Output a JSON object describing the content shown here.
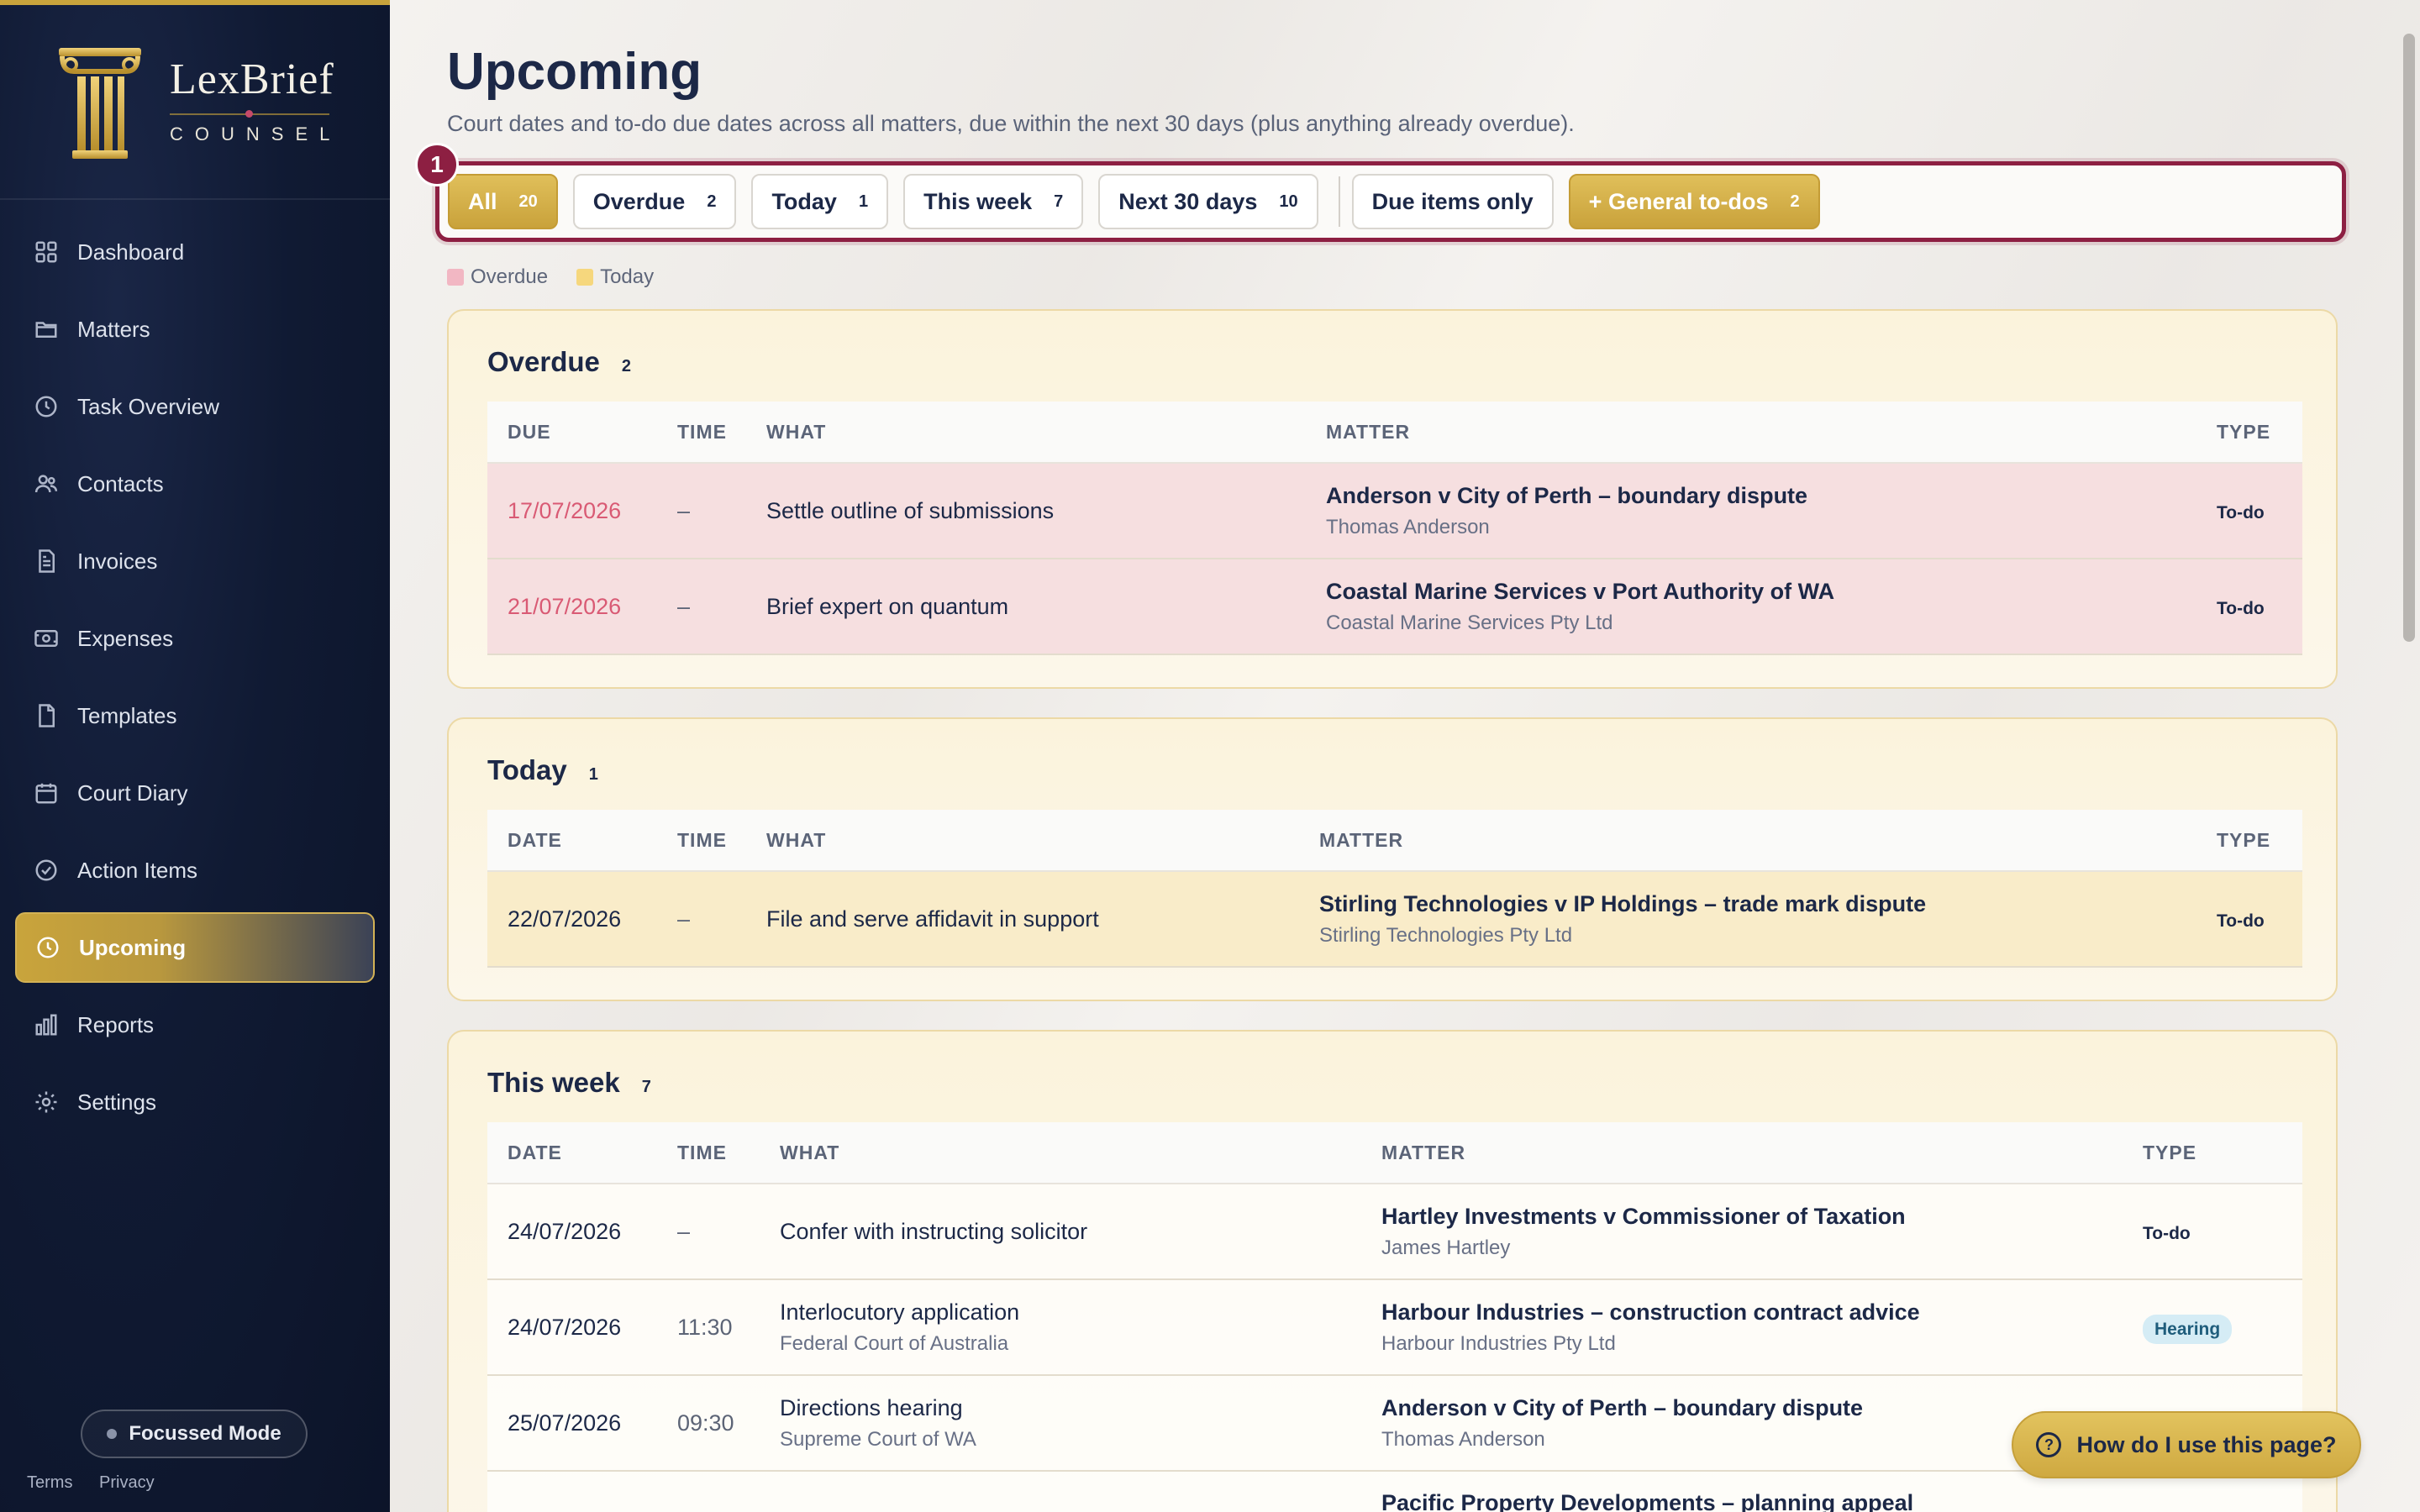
{
  "brand": {
    "name": "LexBrief",
    "sub": "COUNSEL"
  },
  "nav": [
    {
      "label": "Dashboard",
      "icon": "grid-icon"
    },
    {
      "label": "Matters",
      "icon": "folder-icon"
    },
    {
      "label": "Task Overview",
      "icon": "clock-icon"
    },
    {
      "label": "Contacts",
      "icon": "people-icon"
    },
    {
      "label": "Invoices",
      "icon": "invoice-icon"
    },
    {
      "label": "Expenses",
      "icon": "money-icon"
    },
    {
      "label": "Templates",
      "icon": "document-icon"
    },
    {
      "label": "Court Diary",
      "icon": "calendar-icon"
    },
    {
      "label": "Action Items",
      "icon": "check-circle-icon"
    },
    {
      "label": "Upcoming",
      "icon": "clock-icon",
      "active": true
    },
    {
      "label": "Reports",
      "icon": "bar-chart-icon"
    },
    {
      "label": "Settings",
      "icon": "gear-icon"
    }
  ],
  "footer": {
    "focus_mode": "Focussed Mode",
    "terms": "Terms",
    "privacy": "Privacy"
  },
  "page": {
    "title": "Upcoming",
    "subtitle": "Court dates and to-do due dates across all matters, due within the next 30 days (plus anything already overdue).",
    "marker": "1"
  },
  "filters": {
    "all": {
      "label": "All",
      "count": "20"
    },
    "overdue": {
      "label": "Overdue",
      "count": "2"
    },
    "today": {
      "label": "Today",
      "count": "1"
    },
    "week": {
      "label": "This week",
      "count": "7"
    },
    "next30": {
      "label": "Next 30 days",
      "count": "10"
    },
    "due_only": {
      "label": "Due items only"
    },
    "general": {
      "label": "+ General to-dos",
      "count": "2"
    }
  },
  "legend": {
    "overdue": "Overdue",
    "today": "Today"
  },
  "colors": {
    "accent": "#c9a43c",
    "highlight": "#8d1f42",
    "overdue": "#d95a74"
  },
  "sections": {
    "overdue": {
      "title": "Overdue",
      "count": "2",
      "headers": {
        "due": "DUE",
        "time": "TIME",
        "what": "WHAT",
        "matter": "MATTER",
        "type": "TYPE"
      },
      "rows": [
        {
          "due": "17/07/2026",
          "time": "–",
          "what": "Settle outline of submissions",
          "matter": "Anderson v City of Perth – boundary dispute",
          "client": "Thomas Anderson",
          "type": "To-do"
        },
        {
          "due": "21/07/2026",
          "time": "–",
          "what": "Brief expert on quantum",
          "matter": "Coastal Marine Services v Port Authority of WA",
          "client": "Coastal Marine Services Pty Ltd",
          "type": "To-do"
        }
      ]
    },
    "today": {
      "title": "Today",
      "count": "1",
      "headers": {
        "date": "DATE",
        "time": "TIME",
        "what": "WHAT",
        "matter": "MATTER",
        "type": "TYPE"
      },
      "rows": [
        {
          "date": "22/07/2026",
          "time": "–",
          "what": "File and serve affidavit in support",
          "matter": "Stirling Technologies v IP Holdings – trade mark dispute",
          "client": "Stirling Technologies Pty Ltd",
          "type": "To-do"
        }
      ]
    },
    "week": {
      "title": "This week",
      "count": "7",
      "headers": {
        "date": "DATE",
        "time": "TIME",
        "what": "WHAT",
        "matter": "MATTER",
        "type": "TYPE"
      },
      "rows": [
        {
          "date": "24/07/2026",
          "time": "–",
          "what": "Confer with instructing solicitor",
          "what_sub": "",
          "matter": "Hartley Investments v Commissioner of Taxation",
          "client": "James Hartley",
          "type": "To-do"
        },
        {
          "date": "24/07/2026",
          "time": "11:30",
          "what": "Interlocutory application",
          "what_sub": "Federal Court of Australia",
          "matter": "Harbour Industries – construction contract advice",
          "client": "Harbour Industries Pty Ltd",
          "type": "Hearing"
        },
        {
          "date": "25/07/2026",
          "time": "09:30",
          "what": "Directions hearing",
          "what_sub": "Supreme Court of WA",
          "matter": "Anderson v City of Perth – boundary dispute",
          "client": "Thomas Anderson",
          "type": ""
        },
        {
          "date": "",
          "time": "",
          "what": "",
          "what_sub": "",
          "matter": "Pacific Property Developments – planning appeal",
          "client": "",
          "type": ""
        }
      ]
    }
  },
  "help": {
    "label": "How do I use this page?"
  }
}
